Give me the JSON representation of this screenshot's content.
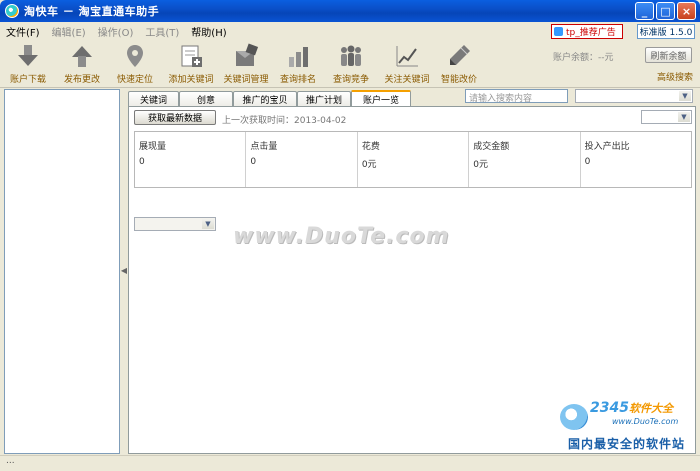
{
  "window": {
    "title": "淘快车 － 淘宝直通车助手",
    "minimize": "_",
    "maximize": "□",
    "close": "×"
  },
  "menu": [
    {
      "label": "文件(F)",
      "enabled": true
    },
    {
      "label": "编辑(E)",
      "enabled": false
    },
    {
      "label": "操作(O)",
      "enabled": false
    },
    {
      "label": "工具(T)",
      "enabled": false
    },
    {
      "label": "帮助(H)",
      "enabled": true
    }
  ],
  "ad_badge": "tp_推荐广告",
  "version": "标准版 1.5.0",
  "toolbar": {
    "items": [
      {
        "label": "账户下载",
        "icon": "download-arrow-icon"
      },
      {
        "label": "发布更改",
        "icon": "upload-arrow-icon"
      },
      {
        "label": "快速定位",
        "icon": "map-pin-icon"
      },
      {
        "label": "添加关键词",
        "icon": "add-keyword-icon"
      },
      {
        "label": "关键词管理",
        "icon": "keyword-manage-icon"
      },
      {
        "label": "查询排名",
        "icon": "bar-chart-icon"
      },
      {
        "label": "查询竞争",
        "icon": "people-icon"
      },
      {
        "label": "关注关键词",
        "icon": "trend-line-icon"
      },
      {
        "label": "智能改价",
        "icon": "pen-icon"
      }
    ],
    "balance": "账户余额：--元",
    "refresh_label": "刷新余额",
    "advanced_search": "高级搜索"
  },
  "tabs": [
    {
      "label": "关键词",
      "active": false
    },
    {
      "label": "创意",
      "active": false
    },
    {
      "label": "推广的宝贝",
      "active": false
    },
    {
      "label": "推广计划",
      "active": false
    },
    {
      "label": "账户一览",
      "active": true
    }
  ],
  "search": {
    "placeholder": "请输入搜索内容"
  },
  "content": {
    "fetch_label": "获取最新数据",
    "last_fetch": "上一次获取时间：2013-04-02",
    "stats": [
      {
        "label": "展现量",
        "value": "0"
      },
      {
        "label": "点击量",
        "value": "0"
      },
      {
        "label": "花费",
        "value": "0元"
      },
      {
        "label": "成交金额",
        "value": "0元"
      },
      {
        "label": "投入产出比",
        "value": "0"
      }
    ]
  },
  "watermark": "www.DuoTe.com",
  "footer_logo": {
    "num_a": "2345",
    "num_b": "软件大全",
    "site": "www.DuoTe.com",
    "slogan": "国内最安全的软件站"
  },
  "statusbar": "..."
}
